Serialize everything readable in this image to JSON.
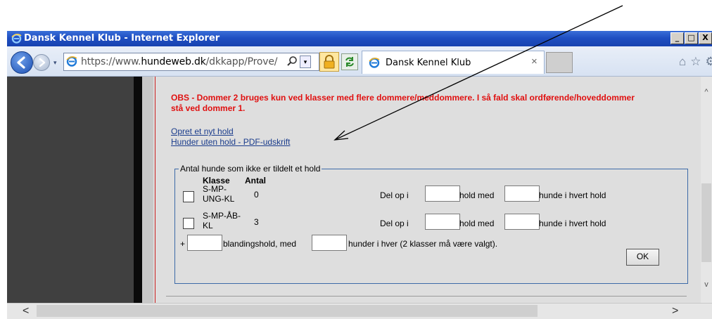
{
  "window": {
    "title": "Dansk Kennel Klub - Internet Explorer",
    "minimize_label": "_",
    "maximize_label": "□",
    "close_label": "X"
  },
  "toolbar": {
    "url_prefix": "https://www.",
    "url_domain": "hundeweb.dk",
    "url_path": "/dkkapp/Prove/",
    "tab_title": "Dansk Kennel Klub",
    "tab_close": "×",
    "history_dropdown": "▾",
    "address_dropdown": "▾",
    "right_icons": [
      "home-icon",
      "favorites-icon",
      "tools-icon"
    ]
  },
  "content": {
    "warning_text": "OBS - Dommer 2 bruges kun ved klasser med flere dommere/meddommere. I så fald skal ordførende/hoveddommer stå ved dommer 1.",
    "links": {
      "new_group": "Opret et nyt hold",
      "dogs_without_group": "Hunder uten hold - PDF-udskrift"
    },
    "fieldset": {
      "legend": "Antal hunde som ikke er tildelt et hold",
      "headers": {
        "klasse": "Klasse",
        "antal": "Antal"
      },
      "rows": [
        {
          "klasse_line1": "S-MP-",
          "klasse_line2": "UNG-KL",
          "antal": "0",
          "split_label": "Del op i",
          "split_value": "",
          "hold_med_label": "hold med",
          "hold_med_value": "",
          "dogs_per_group_label": "hunde i hvert hold"
        },
        {
          "klasse_line1": "S-MP-ÅB-",
          "klasse_line2": "KL",
          "antal": "3",
          "split_label": "Del op i",
          "split_value": "",
          "hold_med_label": "hold med",
          "hold_med_value": "",
          "dogs_per_group_label": "hunde i hvert hold"
        }
      ],
      "mix": {
        "prefix": "+",
        "groups_value": "",
        "groups_label": "blandingshold, med",
        "dogs_value": "",
        "dogs_label": "hunder i hver (2 klasser må være valgt)."
      },
      "ok_label": "OK"
    }
  },
  "scrollbars": {
    "up": "^",
    "down": "v",
    "left": "<",
    "right": ">"
  }
}
